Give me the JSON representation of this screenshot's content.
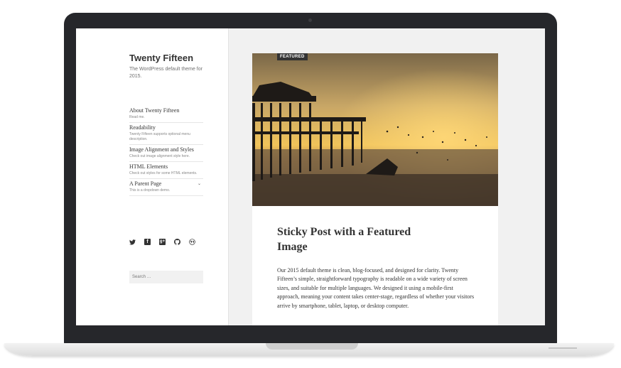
{
  "sidebar": {
    "site_title": "Twenty Fifteen",
    "site_description": "The WordPress default theme for 2015.",
    "menu": [
      {
        "title": "About Twenty Fifteen",
        "desc": "Read me."
      },
      {
        "title": "Readability",
        "desc": "Twenty Fifteen supports optional menu description."
      },
      {
        "title": "Image Alignment and Styles",
        "desc": "Check out image alignment style here."
      },
      {
        "title": "HTML Elements",
        "desc": "Check out styles for some HTML elements."
      },
      {
        "title": "A Parent Page",
        "desc": "This is a dropdown demo."
      }
    ],
    "dropdown_chevron": "⌄",
    "social_icons": [
      "twitter-icon",
      "facebook-icon",
      "google-plus-icon",
      "github-icon",
      "wordpress-icon"
    ],
    "search_placeholder": "Search …"
  },
  "post": {
    "badge": "FEATURED",
    "title": "Sticky Post with a Featured Image",
    "body": "Our 2015 default theme is clean, blog-focused, and designed for clarity. Twenty Fifteen’s simple, straightforward typography is readable on a wide variety of screen sizes, and suitable for multiple languages. We designed it using a mobile-first approach, meaning your content takes center-stage, regardless of whether your visitors arrive by smartphone, tablet, laptop, or desktop computer."
  },
  "colors": {
    "bezel": "#26272b",
    "page_bg": "#f1f1f1",
    "text": "#333333",
    "sky_top": "#b9925a",
    "sky_glow": "#f2c45c"
  }
}
